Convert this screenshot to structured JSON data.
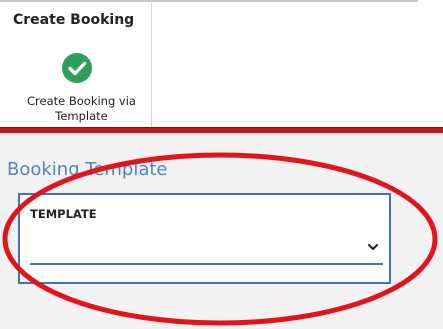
{
  "ribbon": {
    "group_title": "Create Booking",
    "button_label": "Create Booking via Template",
    "icon": "check-circle-icon"
  },
  "section": {
    "title": "Booking Template"
  },
  "field": {
    "label": "TEMPLATE",
    "value": "",
    "icon": "chevron-down-icon"
  },
  "colors": {
    "accent_red": "#c0141c",
    "accent_blue": "#3d73b8",
    "section_title_blue": "#4e84c4",
    "check_green": "#2e9e5a",
    "annotation_red": "#e3121b"
  }
}
